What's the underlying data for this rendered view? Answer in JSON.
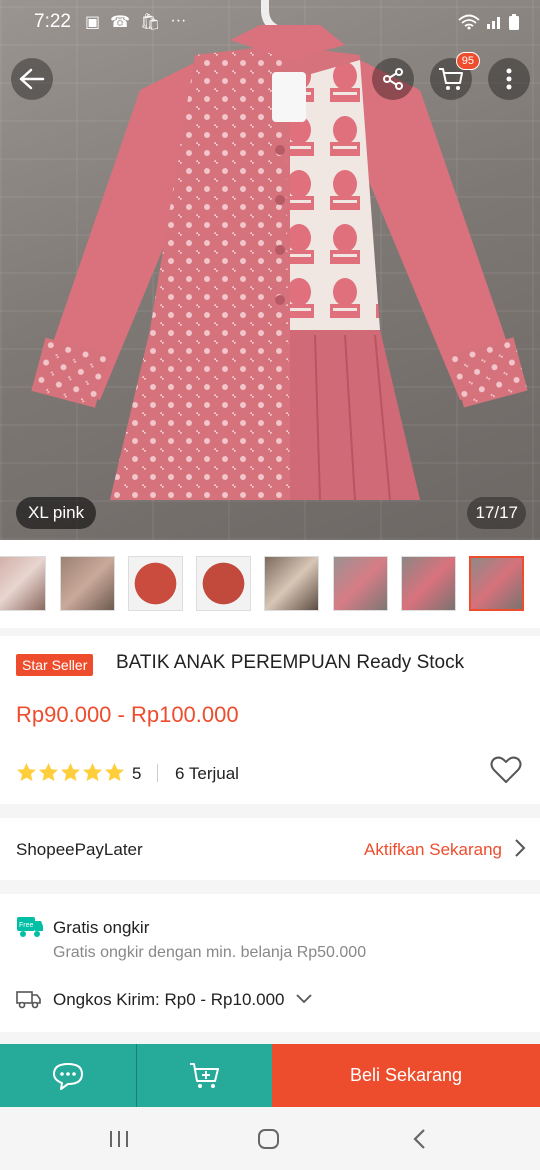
{
  "status": {
    "time": "7:22",
    "dots": "···"
  },
  "hero": {
    "variant_label": "XL pink",
    "image_counter": "17/17",
    "cart_badge": "95"
  },
  "product": {
    "badge": "Star Seller",
    "title": "BATIK ANAK PEREMPUAN Ready Stock",
    "price": "Rp90.000 - Rp100.000",
    "rating": "5",
    "sold": "6 Terjual"
  },
  "paylater": {
    "label": "ShopeePayLater",
    "action": "Aktifkan Sekarang"
  },
  "shipping": {
    "free_icon_text": "Free",
    "title": "Gratis ongkir",
    "subtitle": "Gratis ongkir dengan min. belanja Rp50.000",
    "cost_label": "Ongkos Kirim:",
    "cost_value": "Rp0 - Rp10.000"
  },
  "bottom": {
    "buy_label": "Beli Sekarang"
  },
  "colors": {
    "accent": "#ee4d2d",
    "teal": "#26aa99",
    "shirt": "#d9727d"
  }
}
